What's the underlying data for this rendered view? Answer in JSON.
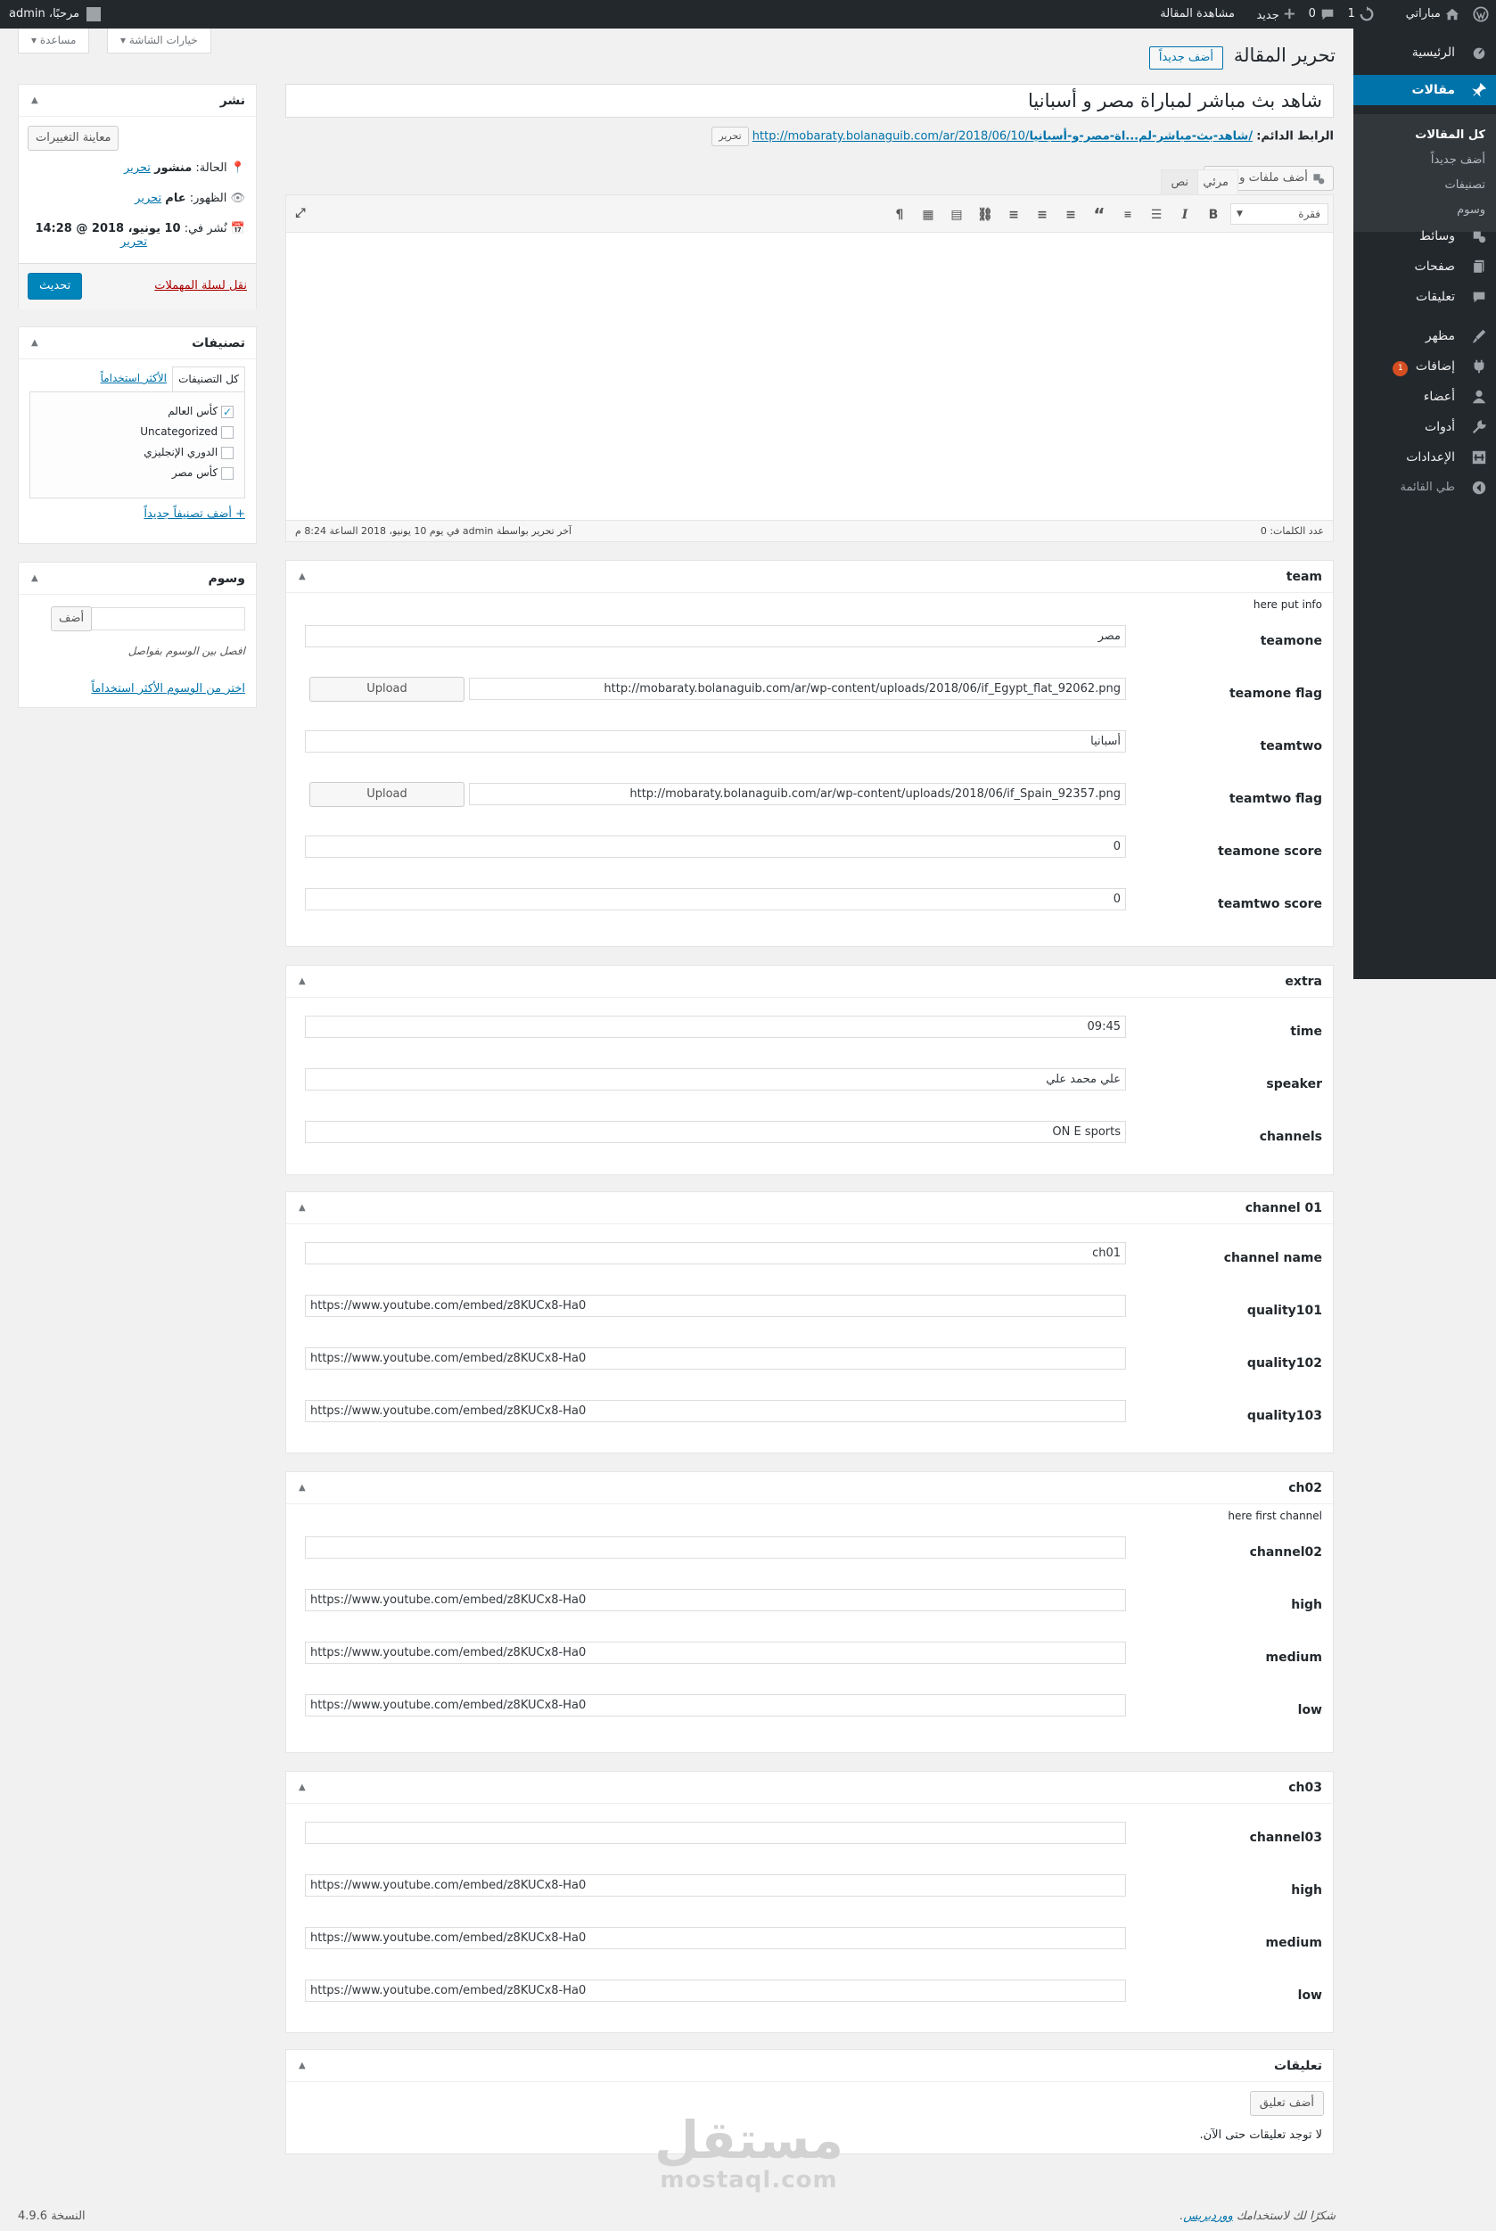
{
  "admin_bar": {
    "howdy": "مرحبًا، admin",
    "view_post": "مشاهدة المقالة",
    "new": "جديد",
    "comments_count": "0",
    "updates_count": "1",
    "site_name": "مباراتي"
  },
  "screen_options": {
    "options_label": "خيارات الشاشة",
    "help_label": "مساعدة"
  },
  "menu": {
    "items": [
      {
        "label": "الرئيسية",
        "icon": "dashboard-icon"
      },
      {
        "label": "مقالات",
        "icon": "pin-icon",
        "current": true
      },
      {
        "label": "وسائط",
        "icon": "media-icon"
      },
      {
        "label": "صفحات",
        "icon": "pages-icon"
      },
      {
        "label": "تعليقات",
        "icon": "comments-icon"
      },
      {
        "label": "مظهر",
        "icon": "appearance-icon"
      },
      {
        "label": "إضافات",
        "icon": "plugins-icon",
        "badge": "1"
      },
      {
        "label": "أعضاء",
        "icon": "users-icon"
      },
      {
        "label": "أدوات",
        "icon": "tools-icon"
      },
      {
        "label": "الإعدادات",
        "icon": "settings-icon"
      },
      {
        "label": "طي القائمة",
        "icon": "collapse-icon"
      }
    ],
    "submenu": [
      "كل المقالات",
      "أضف جديداً",
      "تصنيفات",
      "وسوم"
    ]
  },
  "header": {
    "title": "تحرير المقالة",
    "add_new": "أضف جديداً"
  },
  "post": {
    "title": "شاهد بث مباشر لمباراة مصر و أسبانيا",
    "permalink_label": "الرابط الدائم:",
    "permalink_base": "http://mobaraty.bolanaguib.com/ar/2018/06/10/",
    "permalink_slug": "شاهد-بث-مباشر-لم...اة-مصر-و-أسبانيا/",
    "permalink_edit": "تحرير"
  },
  "editor": {
    "add_media": "أضف ملفات وسائط",
    "tab_visual": "مرئي",
    "tab_text": "نص",
    "format_select": "فقرة",
    "word_count": "عدد الكلمات: 0",
    "last_edited": "آخر تحرير بواسطة admin في يوم 10 يونيو، 2018 الساعة 8:24 م"
  },
  "boxes": {
    "team": {
      "title": "team",
      "desc": "here put info",
      "fields": [
        {
          "label": "teamone",
          "value": "مصر"
        },
        {
          "label": "teamone flag",
          "value": "http://mobaraty.bolanaguib.com/ar/wp-content/uploads/2018/06/if_Egypt_flat_92062.png",
          "button": "Upload"
        },
        {
          "label": "teamtwo",
          "value": "أسبانيا"
        },
        {
          "label": "teamtwo flag",
          "value": "http://mobaraty.bolanaguib.com/ar/wp-content/uploads/2018/06/if_Spain_92357.png",
          "button": "Upload"
        },
        {
          "label": "teamone score",
          "value": "0"
        },
        {
          "label": "teamtwo score",
          "value": "0"
        }
      ]
    },
    "extra": {
      "title": "extra",
      "fields": [
        {
          "label": "time",
          "value": "09:45"
        },
        {
          "label": "speaker",
          "value": "علي محمد علي"
        },
        {
          "label": "channels",
          "value": "ON E sports"
        }
      ]
    },
    "channel01": {
      "title": "channel 01",
      "fields": [
        {
          "label": "channel name",
          "value": "ch01"
        },
        {
          "label": "quality101",
          "value": "https://www.youtube.com/embed/z8KUCx8-Ha0"
        },
        {
          "label": "quality102",
          "value": "https://www.youtube.com/embed/z8KUCx8-Ha0"
        },
        {
          "label": "quality103",
          "value": "https://www.youtube.com/embed/z8KUCx8-Ha0"
        }
      ]
    },
    "ch02": {
      "title": "ch02",
      "desc": "here first channel",
      "fields": [
        {
          "label": "channel02",
          "value": ""
        },
        {
          "label": "high",
          "value": "https://www.youtube.com/embed/z8KUCx8-Ha0"
        },
        {
          "label": "medium",
          "value": "https://www.youtube.com/embed/z8KUCx8-Ha0"
        },
        {
          "label": "low",
          "value": "https://www.youtube.com/embed/z8KUCx8-Ha0"
        }
      ]
    },
    "ch03": {
      "title": "ch03",
      "fields": [
        {
          "label": "channel03",
          "value": ""
        },
        {
          "label": "high",
          "value": "https://www.youtube.com/embed/z8KUCx8-Ha0"
        },
        {
          "label": "medium",
          "value": "https://www.youtube.com/embed/z8KUCx8-Ha0"
        },
        {
          "label": "low",
          "value": "https://www.youtube.com/embed/z8KUCx8-Ha0"
        }
      ]
    },
    "comments": {
      "title": "تعليقات",
      "add_comment": "أضف تعليق",
      "no_comments": "لا توجد تعليقات حتى الآن."
    }
  },
  "publish": {
    "title": "نشر",
    "preview": "معاينة التغييرات",
    "status_label": "الحالة:",
    "status_value": "منشور",
    "visibility_label": "الظهور:",
    "visibility_value": "عام",
    "published_label": "نُشر في:",
    "published_value": "10 يونيو، 2018 @ 14:28",
    "edit": "تحرير",
    "trash": "نقل لسلة المهملات",
    "update": "تحديث"
  },
  "categories": {
    "title": "تصنيفات",
    "tab_all": "كل التصنيفات",
    "tab_popular": "الأكثر استخداماً",
    "items": [
      {
        "label": "كأس العالم",
        "checked": true
      },
      {
        "label": "Uncategorized",
        "checked": false
      },
      {
        "label": "الدوري الإنجليزي",
        "checked": false
      },
      {
        "label": "كأس مصر",
        "checked": false
      }
    ],
    "add_new": "+ أضف تصنيفاً جديداً"
  },
  "tags": {
    "title": "وسوم",
    "add_button": "أضف",
    "hint": "افصل بين الوسوم بفواصل",
    "choose": "اختر من الوسوم الأكثر استخداماً"
  },
  "footer": {
    "thanks_prefix": "شكرًا لك لاستخدامك",
    "thanks_link": "ووردبريس",
    "version": "النسخة 4.9.6"
  },
  "watermark": {
    "arabic": "مستقل",
    "latin": "mostaql.com"
  },
  "colors": {
    "accent": "#0073aa",
    "admin_bar": "#23282d",
    "badge": "#d54e21",
    "trash": "#a00"
  }
}
